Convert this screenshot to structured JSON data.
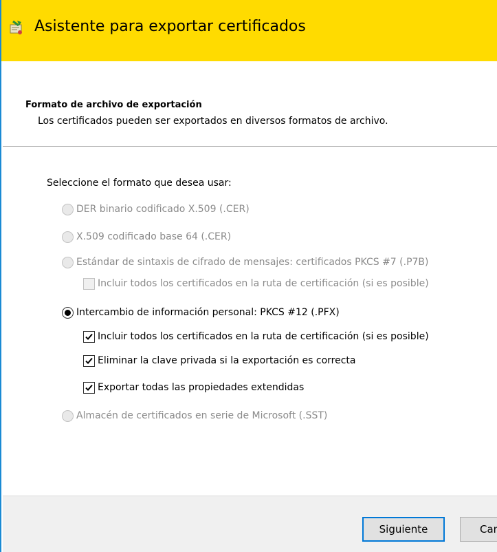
{
  "window": {
    "title": "Asistente para exportar certificados",
    "icon": "certificate-wizard-icon",
    "accent_color": "#ffdb00",
    "border_color": "#1a8ad4"
  },
  "header": {
    "title": "Formato de archivo de exportación",
    "subtitle": "Los certificados pueden ser exportados en diversos formatos de archivo."
  },
  "prompt": "Seleccione el formato que desea usar:",
  "options": {
    "der": {
      "label": "DER binario codificado X.509 (.CER)",
      "selected": false,
      "enabled": false
    },
    "base64": {
      "label": "X.509 codificado base 64 (.CER)",
      "selected": false,
      "enabled": false
    },
    "pkcs7": {
      "label": "Estándar de sintaxis de cifrado de mensajes: certificados PKCS #7 (.P7B)",
      "selected": false,
      "enabled": false
    },
    "pkcs7_include_all": {
      "label": "Incluir todos los certificados en la ruta de certificación (si es posible)",
      "checked": false,
      "enabled": false
    },
    "pfx": {
      "label": "Intercambio de información personal: PKCS #12 (.PFX)",
      "selected": true,
      "enabled": true
    },
    "pfx_include_all": {
      "label": "Incluir todos los certificados en la ruta de certificación (si es posible)",
      "checked": true,
      "enabled": true
    },
    "pfx_delete_key": {
      "label": "Eliminar la clave privada si la exportación es correcta",
      "checked": true,
      "enabled": true
    },
    "pfx_export_props": {
      "label": "Exportar todas las propiedades extendidas",
      "checked": true,
      "enabled": true
    },
    "sst": {
      "label": "Almacén de certificados en serie de Microsoft (.SST)",
      "selected": false,
      "enabled": false
    }
  },
  "buttons": {
    "next": "Siguiente",
    "cancel": "Can"
  }
}
